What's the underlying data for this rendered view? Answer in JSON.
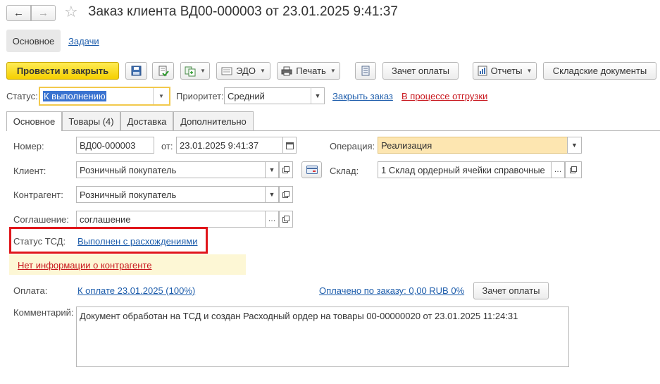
{
  "window": {
    "title": "Заказ клиента ВД00-000003 от 23.01.2025 9:41:37"
  },
  "nav": {
    "back": "←",
    "forward": "→",
    "favorite": "☆"
  },
  "section_tabs": [
    {
      "label": "Основное"
    },
    {
      "label": "Задачи"
    }
  ],
  "toolbar": {
    "post_close": "Провести и закрыть",
    "edo": "ЭДО",
    "print": "Печать",
    "payment_offset": "Зачет оплаты",
    "reports": "Отчеты",
    "warehouse_docs": "Складские документы"
  },
  "status_row": {
    "status_label": "Статус:",
    "status_value": "К выполнению",
    "priority_label": "Приоритет:",
    "priority_value": "Средний",
    "close_order_link": "Закрыть заказ",
    "shipping_link": "В процессе отгрузки"
  },
  "tabs": [
    {
      "label": "Основное"
    },
    {
      "label": "Товары (4)"
    },
    {
      "label": "Доставка"
    },
    {
      "label": "Дополнительно"
    }
  ],
  "form": {
    "number_label": "Номер:",
    "number_value": "ВД00-000003",
    "date_label": "от:",
    "date_value": "23.01.2025  9:41:37",
    "operation_label": "Операция:",
    "operation_value": "Реализация",
    "client_label": "Клиент:",
    "client_value": "Розничный покупатель",
    "warehouse_label": "Склад:",
    "warehouse_value": "1 Склад ордерный ячейки справочные",
    "counterparty_label": "Контрагент:",
    "counterparty_value": "Розничный покупатель",
    "agreement_label": "Соглашение:",
    "agreement_value": "соглашение",
    "tsd_label": "Статус ТСД:",
    "tsd_value": "Выполнен с расхождениями",
    "no_info_link": "Нет информации о контрагенте",
    "payment_label": "Оплата:",
    "payment_link": "К оплате 23.01.2025 (100%)",
    "paid_link": "Оплачено по заказу: 0,00 RUB 0%",
    "payment_offset_btn": "Зачет оплаты",
    "comment_label": "Комментарий:",
    "comment_value": "Документ обработан на ТСД и создан Расходный ордер на товары 00-00000020 от 23.01.2025 11:24:31"
  },
  "colors": {
    "accent_yellow": "#f5cf00",
    "link_blue": "#1c5cab",
    "link_red": "#c8161d",
    "highlight_box": "#e0161b",
    "operation_bg": "#fde6b1",
    "warning_bg": "#fdf7d5"
  }
}
